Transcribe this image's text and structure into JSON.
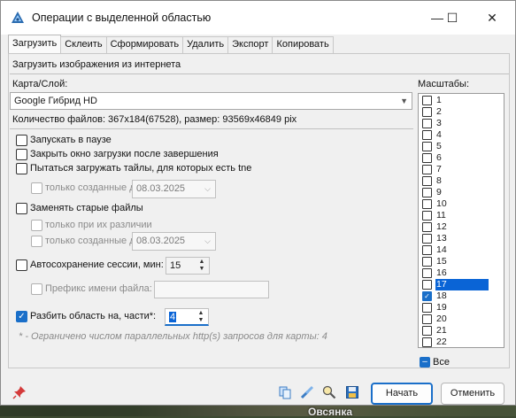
{
  "window": {
    "title": "Операции с выделенной областью",
    "minimize_glyph": "—",
    "maximize_glyph": "☐",
    "close_glyph": "✕"
  },
  "tabs": [
    {
      "label": "Загрузить",
      "active": true
    },
    {
      "label": "Склеить",
      "active": false
    },
    {
      "label": "Сформировать",
      "active": false
    },
    {
      "label": "Удалить",
      "active": false
    },
    {
      "label": "Экспорт",
      "active": false
    },
    {
      "label": "Копировать",
      "active": false
    }
  ],
  "download": {
    "heading": "Загрузить изображения из интернета",
    "map_label": "Карта/Слой:",
    "map_value": "Google Гибрид HD",
    "file_info": "Количество файлов: 367x184(67528), размер: 93569x46849 pix",
    "options": {
      "start_paused": {
        "label": "Запускать в паузе",
        "checked": false
      },
      "close_after": {
        "label": "Закрыть окно загрузки после завершения",
        "checked": false
      },
      "try_tne": {
        "label": "Пытаться загружать тайлы, для которых есть tne",
        "checked": false
      },
      "only_created_1": {
        "label": "только созданные до",
        "checked": false,
        "date": "08.03.2025"
      },
      "replace_old": {
        "label": "Заменять старые файлы",
        "checked": false
      },
      "only_diff": {
        "label": "только при их различии",
        "checked": false
      },
      "only_created_2": {
        "label": "только созданные до",
        "checked": false,
        "date": "08.03.2025"
      },
      "autosave": {
        "label": "Автосохранение сессии, мин:",
        "checked": false,
        "value": "15"
      },
      "prefix": {
        "label": "Префикс имени файла:",
        "checked": false,
        "value": ""
      },
      "split": {
        "label": "Разбить область на, части*:",
        "checked": true,
        "value": "4"
      }
    },
    "footnote": "* - Ограничено числом параллельных http(s) запросов для карты: 4"
  },
  "scales": {
    "label": "Масштабы:",
    "items": [
      {
        "label": "1",
        "checked": false,
        "selected": false
      },
      {
        "label": "2",
        "checked": false,
        "selected": false
      },
      {
        "label": "3",
        "checked": false,
        "selected": false
      },
      {
        "label": "4",
        "checked": false,
        "selected": false
      },
      {
        "label": "5",
        "checked": false,
        "selected": false
      },
      {
        "label": "6",
        "checked": false,
        "selected": false
      },
      {
        "label": "7",
        "checked": false,
        "selected": false
      },
      {
        "label": "8",
        "checked": false,
        "selected": false
      },
      {
        "label": "9",
        "checked": false,
        "selected": false
      },
      {
        "label": "10",
        "checked": false,
        "selected": false
      },
      {
        "label": "11",
        "checked": false,
        "selected": false
      },
      {
        "label": "12",
        "checked": false,
        "selected": false
      },
      {
        "label": "13",
        "checked": false,
        "selected": false
      },
      {
        "label": "14",
        "checked": false,
        "selected": false
      },
      {
        "label": "15",
        "checked": false,
        "selected": false
      },
      {
        "label": "16",
        "checked": false,
        "selected": false
      },
      {
        "label": "17",
        "checked": false,
        "selected": true
      },
      {
        "label": "18",
        "checked": true,
        "selected": false
      },
      {
        "label": "19",
        "checked": false,
        "selected": false
      },
      {
        "label": "20",
        "checked": false,
        "selected": false
      },
      {
        "label": "21",
        "checked": false,
        "selected": false
      },
      {
        "label": "22",
        "checked": false,
        "selected": false
      }
    ],
    "all_label": "Все"
  },
  "buttons": {
    "start": "Начать",
    "cancel": "Отменить"
  },
  "background": {
    "map_text": "Овсянка"
  },
  "colors": {
    "accent": "#1a6fc9",
    "selection": "#0a64d6"
  }
}
